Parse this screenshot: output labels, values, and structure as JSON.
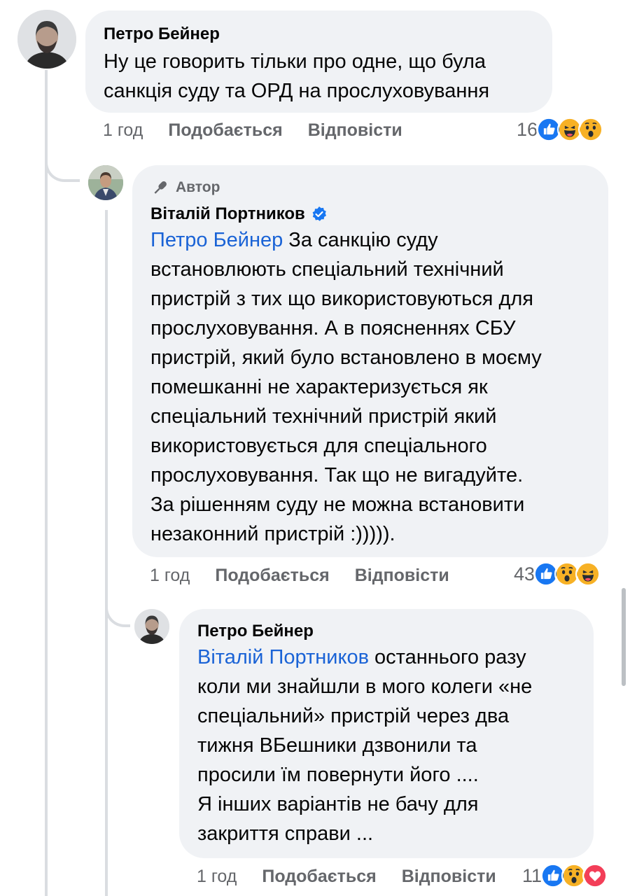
{
  "comment1": {
    "author": "Петро Бейнер",
    "text": "Ну це говорить тільки про одне, що була\nсанкція суду та ОРД на прослуховування",
    "time": "1 год",
    "like_label": "Подобається",
    "reply_label": "Відповісти",
    "reaction_count": "16",
    "reactions": [
      "like-icon",
      "haha-icon",
      "wow-icon"
    ]
  },
  "comment2": {
    "badge": "Автор",
    "author": "Віталій Портников",
    "mention": "Петро Бейнер",
    "text": " За санкцію суду\nвстановлюють спеціальний технічний\nпристрій з тих що використовуються для\nпрослуховування. А в поясненнях СБУ\nпристрій, який було встановлено в моєму\nпомешканні не характеризується як\nспеціальний технічний пристрій який\nвикористовується для спеціального\nпрослуховування. Так що не вигадуйте.\nЗа рішенням суду не можна встановити\nнезаконний пристрій :))))).",
    "time": "1 год",
    "like_label": "Подобається",
    "reply_label": "Відповісти",
    "reaction_count": "43",
    "reactions": [
      "like-icon",
      "wow-icon",
      "haha-icon"
    ]
  },
  "comment3": {
    "author": "Петро Бейнер",
    "mention": "Віталій Портников",
    "text": "  останнього разу\nколи ми знайшли в мого колеги «не\nспеціальний» пристрій через два\nтижня ВБешники дзвонили та\nпросили їм повернути його ....\nЯ інших варіантів не бачу для\nзакриття справи ...",
    "time": "1 год",
    "like_label": "Подобається",
    "reply_label": "Відповісти",
    "reaction_count": "11",
    "reactions": [
      "like-icon",
      "wow-icon",
      "love-icon"
    ]
  },
  "colors": {
    "link": "#1a63d6",
    "bubble": "#f0f2f5",
    "secondary_text": "#65676b",
    "like_blue": "#1877f2",
    "emoji_yellow": "#f7b125",
    "love_red": "#f33e58"
  }
}
